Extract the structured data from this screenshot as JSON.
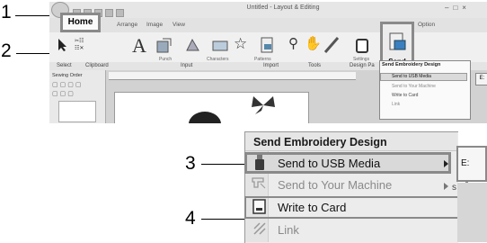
{
  "callouts": [
    "1",
    "2",
    "3",
    "4"
  ],
  "top_window": {
    "title": "Untitled - Layout & Editing",
    "tabs": [
      "Home",
      "Arrange",
      "Image",
      "View"
    ],
    "option_menu": "Option",
    "group_labels": [
      "Select",
      "Clipboard",
      "Input",
      "Import",
      "Tools",
      "Design Pa"
    ],
    "ribbon_labels": [
      "Punch",
      "Characters",
      "Patterns",
      "Settings"
    ],
    "side_panel_label": "Sewing Order",
    "send_button_label": "Send",
    "send_menu": {
      "title": "Send Embroidery Design",
      "items": [
        "Send to USB Media",
        "Send to Your Machine",
        "Write to Card",
        "Link"
      ],
      "submenu_value": "E:"
    }
  },
  "zoom_menu": {
    "title": "Send Embroidery Design",
    "items": [
      {
        "label": "Send to USB Media",
        "enabled": true,
        "has_submenu": true,
        "icon": "usb-icon"
      },
      {
        "label": "Send to Your Machine",
        "enabled": false,
        "has_submenu": true,
        "icon": "machine-icon"
      },
      {
        "label": "Write to Card",
        "enabled": true,
        "has_submenu": false,
        "icon": "card-icon"
      },
      {
        "label": "Link",
        "enabled": false,
        "has_submenu": false,
        "icon": "link-icon"
      }
    ],
    "submenu_value": "E:",
    "partial_text": "s"
  }
}
